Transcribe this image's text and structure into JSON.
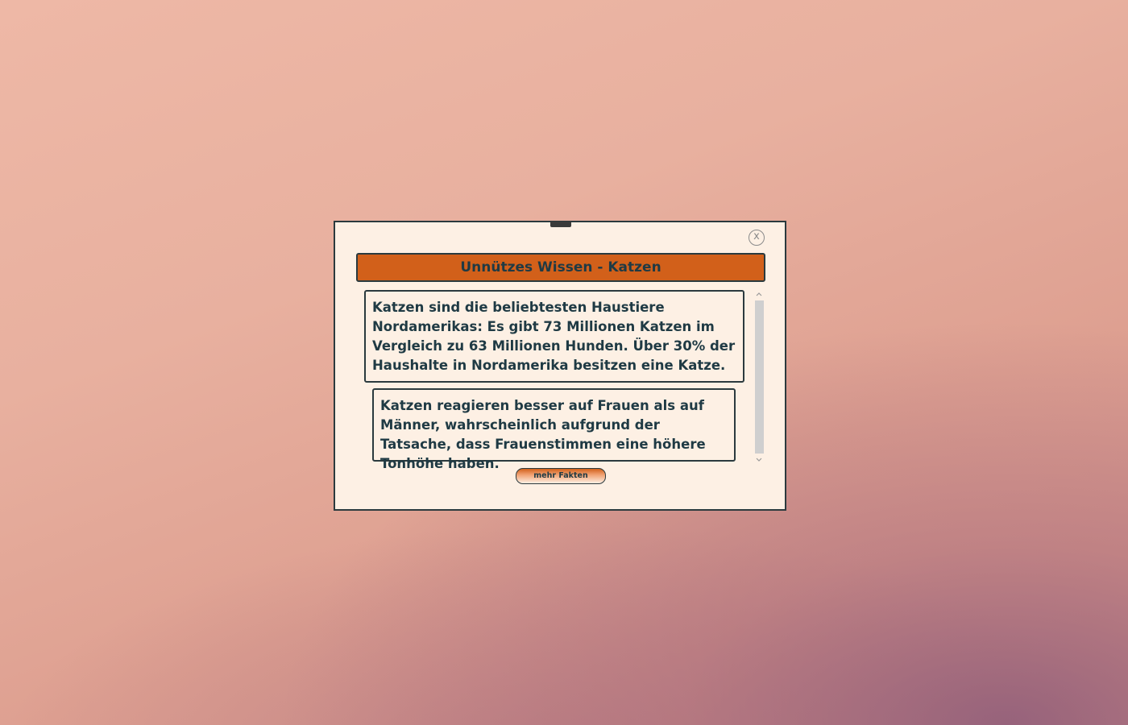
{
  "dialog": {
    "close_label": "x",
    "title": "Unnützes Wissen - Katzen",
    "facts": [
      {
        "text": "Katzen sind die beliebtesten Haustiere Nordamerikas: Es gibt 73 Millionen Katzen im Vergleich zu 63 Millionen Hunden. Über 30% der Haushalte in Nordamerika besitzen eine Katze."
      },
      {
        "text": "Katzen reagieren besser auf Frauen als auf Männer, wahrscheinlich aufgrund der Tatsache, dass Frauenstimmen eine höhere Tonhöhe haben."
      }
    ],
    "more_button_label": "mehr Fakten",
    "scroll_up_icon": "chevron-up-icon",
    "scroll_down_icon": "chevron-down-icon"
  },
  "colors": {
    "dialog_background": "#fdf0e4",
    "title_background": "#d2601a",
    "border": "#2b3a3e",
    "text": "#1f3a44"
  }
}
